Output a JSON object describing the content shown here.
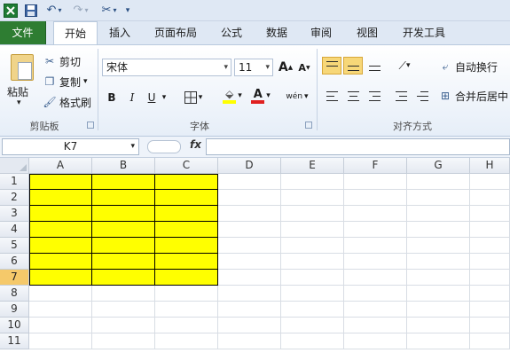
{
  "quick_access": {
    "icons": [
      "excel-logo-icon",
      "save-icon",
      "undo-icon",
      "redo-icon",
      "custom-tool-icon",
      "customize-toolbar-icon"
    ]
  },
  "tabs": [
    {
      "label": "文件"
    },
    {
      "label": "开始"
    },
    {
      "label": "插入"
    },
    {
      "label": "页面布局"
    },
    {
      "label": "公式"
    },
    {
      "label": "数据"
    },
    {
      "label": "审阅"
    },
    {
      "label": "视图"
    },
    {
      "label": "开发工具"
    }
  ],
  "ribbon": {
    "clipboard": {
      "paste": "粘贴",
      "cut": "剪切",
      "copy": "复制",
      "format_painter": "格式刷",
      "group": "剪贴板"
    },
    "font": {
      "name": "宋体",
      "size": "11",
      "bold": "B",
      "italic": "I",
      "underline": "U",
      "group": "字体",
      "grow": "A",
      "shrink": "A",
      "font_color_letter": "A",
      "wen": "wén"
    },
    "alignment": {
      "wrap": "自动换行",
      "merge": "合并后居中",
      "group": "对齐方式"
    }
  },
  "formula_bar": {
    "name_box": "K7",
    "fx": "fx",
    "value": ""
  },
  "grid": {
    "columns": [
      "A",
      "B",
      "C",
      "D",
      "E",
      "F",
      "G",
      "H"
    ],
    "rows": [
      "1",
      "2",
      "3",
      "4",
      "5",
      "6",
      "7",
      "8",
      "9",
      "10",
      "11"
    ],
    "selected_row": "7",
    "fill_color": "#ffff00"
  }
}
